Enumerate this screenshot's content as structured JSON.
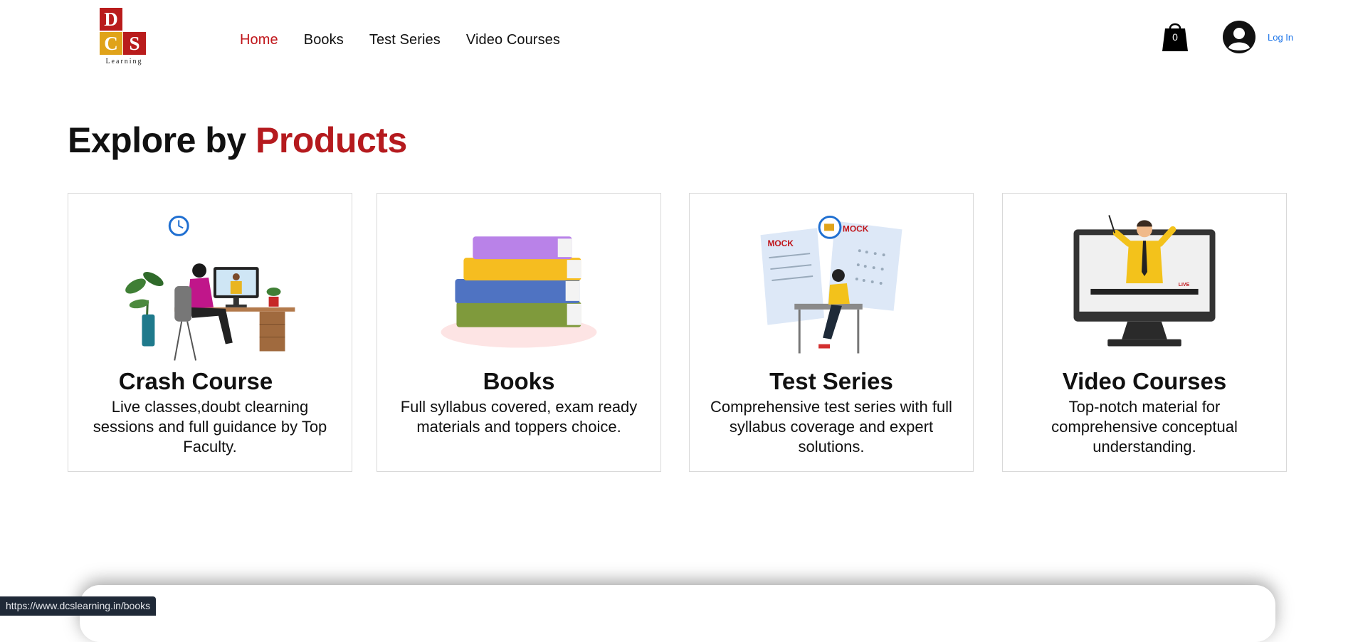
{
  "brand": {
    "letters": [
      "D",
      "C",
      "S"
    ],
    "word": "Learning"
  },
  "nav": {
    "items": [
      {
        "label": "Home",
        "active": true
      },
      {
        "label": "Books"
      },
      {
        "label": "Test Series"
      },
      {
        "label": "Video Courses"
      }
    ]
  },
  "header": {
    "cart_count": "0",
    "login_label": "Log In"
  },
  "section": {
    "title_prefix": "Explore by",
    "title_accent": "Products"
  },
  "products": [
    {
      "title": "Crash Course",
      "description": "Live classes,doubt clearning sessions and full guidance by Top Faculty."
    },
    {
      "title": "Books",
      "description": "Full syllabus covered, exam ready materials and toppers choice."
    },
    {
      "title": "Test Series",
      "description": "Comprehensive test series with full syllabus coverage and expert solutions."
    },
    {
      "title": "Video Courses",
      "description": "Top-notch material for comprehensive conceptual understanding."
    }
  ],
  "illustration_text": {
    "mock": "MOCK",
    "live": "LIVE"
  },
  "status_bar": {
    "url": "https://www.dcslearning.in/books"
  },
  "colors": {
    "accent": "#c0161b",
    "link": "#1a73e8",
    "logo_gold": "#e0a31a"
  }
}
